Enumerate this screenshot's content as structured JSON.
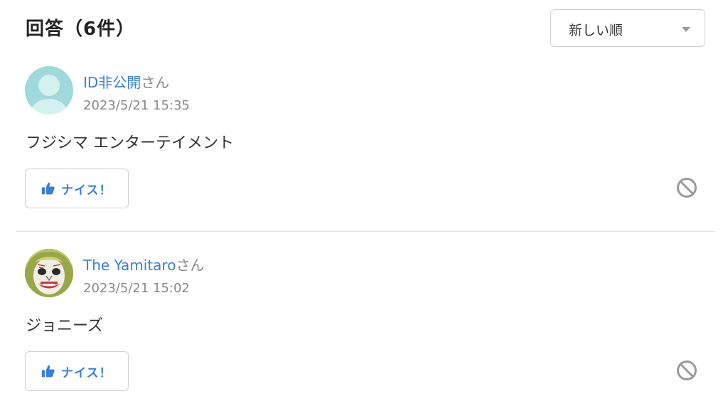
{
  "header": {
    "title": "回答（6件）",
    "sort": {
      "selected": "新しい順",
      "icon": "caret-down-icon"
    }
  },
  "answers": [
    {
      "user": {
        "name": "ID非公開",
        "suffix": "さん",
        "avatar": "default-user-avatar"
      },
      "timestamp": "2023/5/21 15:35",
      "text": "フジシマ エンターテイメント",
      "nice_label": "ナイス！",
      "nice_icon": "thumbs-up-icon",
      "report_icon": "prohibited-icon"
    },
    {
      "user": {
        "name": "The Yamitaro",
        "suffix": "さん",
        "avatar": "joker-face-avatar"
      },
      "timestamp": "2023/5/21 15:02",
      "text": "ジョニーズ",
      "nice_label": "ナイス！",
      "nice_icon": "thumbs-up-icon",
      "report_icon": "prohibited-icon"
    }
  ],
  "colors": {
    "link": "#3b7fd4",
    "muted": "#888888",
    "text": "#333333",
    "avatar_default": "#9fd9d9"
  }
}
